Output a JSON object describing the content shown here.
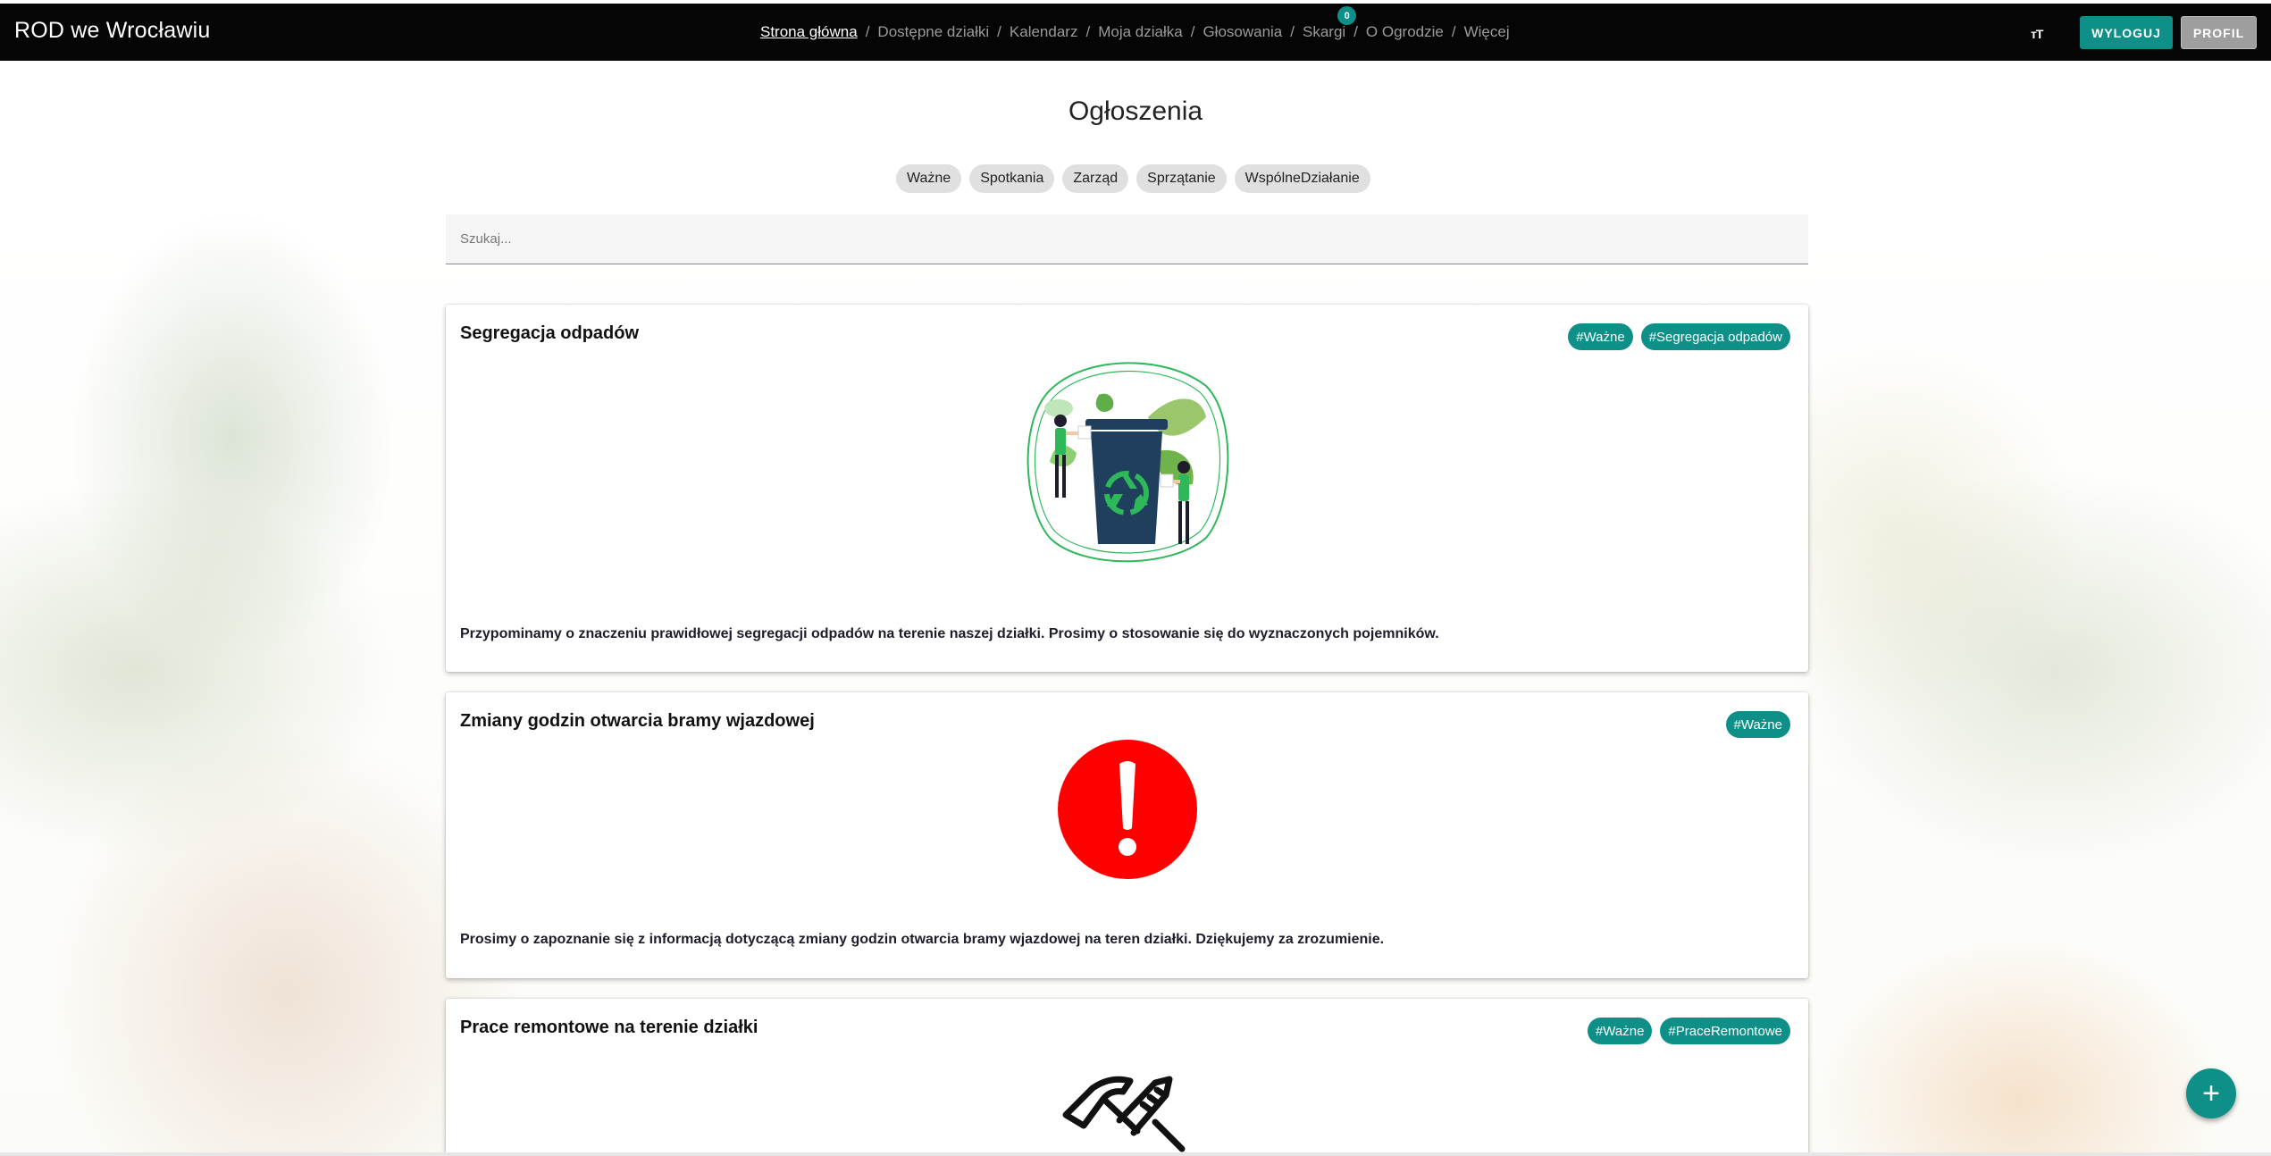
{
  "header": {
    "brand": "ROD we Wrocławiu",
    "nav": [
      {
        "label": "Strona główna"
      },
      {
        "label": "Dostępne działki"
      },
      {
        "label": "Kalendarz"
      },
      {
        "label": "Moja działka"
      },
      {
        "label": "Głosowania"
      },
      {
        "label": "Skargi",
        "badge": "0"
      },
      {
        "label": "O Ogrodzie"
      },
      {
        "label": "Więcej"
      }
    ],
    "separator": "/",
    "font_size_icon": "тT",
    "logout_label": "WYLOGUJ",
    "profile_label": "PROFIL"
  },
  "main": {
    "title": "Ogłoszenia",
    "filters": [
      "Ważne",
      "Spotkania",
      "Zarząd",
      "Sprzątanie",
      "WspólneDziałanie"
    ],
    "search_placeholder": "Szukaj..."
  },
  "posts": [
    {
      "title": "Segregacja odpadów",
      "tags": [
        "#Ważne",
        "#Segregacja odpadów"
      ],
      "image": "recycling-bin-illustration",
      "text": "Przypominamy o znaczeniu prawidłowej segregacji odpadów na terenie naszej działki. Prosimy o stosowanie się do wyznaczonych pojemników."
    },
    {
      "title": "Zmiany godzin otwarcia bramy wjazdowej",
      "tags": [
        "#Ważne"
      ],
      "image": "exclamation-icon",
      "text": "Prosimy o zapoznanie się z informacją dotyczącą zmiany godzin otwarcia bramy wjazdowej na teren działki. Dziękujemy za zrozumienie."
    },
    {
      "title": "Prace remontowe na terenie działki",
      "tags": [
        "#Ważne",
        "#PraceRemontowe"
      ],
      "image": "tools-icon",
      "text": ""
    }
  ],
  "fab_label": "+",
  "colors": {
    "accent": "#0e9088",
    "topbar": "#050505",
    "alert_red": "#ff0000",
    "recycle_green": "#2fb85a",
    "bin_navy": "#1f3f5c"
  }
}
